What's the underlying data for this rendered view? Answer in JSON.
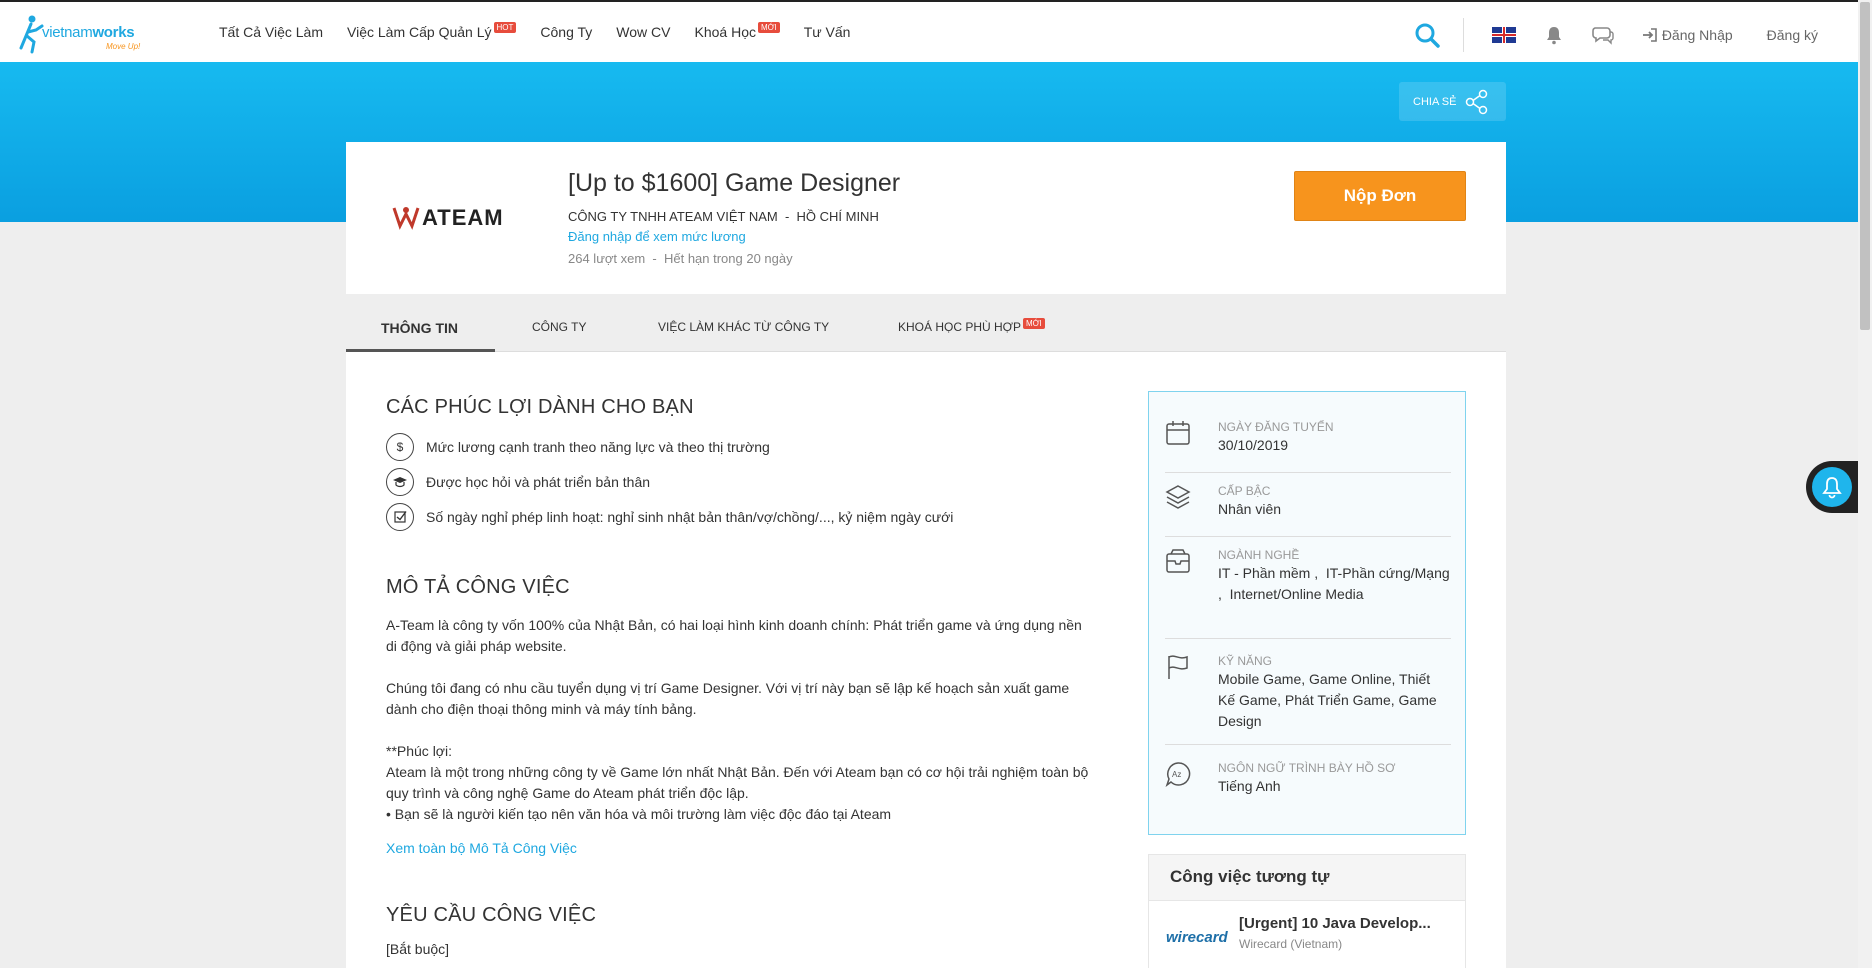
{
  "brand": {
    "name_light": "vietnam",
    "name_bold": "works",
    "tagline": "Move Up!"
  },
  "nav": {
    "items": [
      {
        "label": "Tất Cả Việc Làm",
        "badge": ""
      },
      {
        "label": "Việc Làm Cấp Quản Lý",
        "badge": "HOT"
      },
      {
        "label": "Công Ty",
        "badge": ""
      },
      {
        "label": "Wow CV",
        "badge": ""
      },
      {
        "label": "Khoá Học",
        "badge": "MỚI"
      },
      {
        "label": "Tư Vấn",
        "badge": ""
      }
    ],
    "login": "Đăng Nhập",
    "register": "Đăng ký"
  },
  "share_label": "CHIA SẺ",
  "job": {
    "title": "[Up to $1600] Game Designer",
    "company": "CÔNG TY TNHH ATEAM VIỆT NAM",
    "location": "HỒ CHÍ MINH",
    "company_line": "CÔNG TY TNHH ATEAM VIỆT NAM  -  HỒ CHÍ MINH",
    "salary_login": "Đăng nhập để xem mức lương",
    "meta": "264 lượt xem  -  Hết hạn trong 20 ngày",
    "apply": "Nộp Đơn",
    "company_logo_text": "ATEAM"
  },
  "tabs": [
    {
      "label": "THÔNG TIN"
    },
    {
      "label": "CÔNG TY"
    },
    {
      "label": "VIỆC LÀM KHÁC TỪ CÔNG TY"
    },
    {
      "label": "KHOÁ HỌC PHÙ HỢP",
      "badge": "MỚI"
    }
  ],
  "benefits": {
    "heading": "CÁC PHÚC LỢI DÀNH CHO BẠN",
    "items": [
      {
        "icon": "dollar-icon",
        "text": "Mức lương cạnh tranh theo năng lực và theo thị trường"
      },
      {
        "icon": "graduation-cap-icon",
        "text": "Được học hỏi và phát triển bản thân"
      },
      {
        "icon": "checkbox-icon",
        "text": "Số ngày nghỉ phép linh hoạt: nghỉ sinh nhật bản thân/vợ/chồng/..., kỷ niệm ngày cưới"
      }
    ]
  },
  "description": {
    "heading": "MÔ TẢ CÔNG VIỆC",
    "p1": "A-Team là công ty vốn 100% của Nhật Bản, có hai loại hình kinh doanh chính: Phát triển game và ứng dụng nền di động và giải pháp website.",
    "p2": "Chúng tôi đang có nhu cầu tuyển dụng vị trí Game Designer. Với vị trí này bạn sẽ lập kế hoạch sản xuất game dành cho điện thoại thông minh và máy tính bảng.",
    "p3_title": "**Phúc lợi:",
    "p3_body": "Ateam là một trong những công ty về Game lớn nhất Nhật Bản. Đến với Ateam bạn có cơ hội trải nghiệm toàn bộ quy trình và công nghệ Game do Ateam phát triển độc lập.",
    "p3_bullet": "• Bạn sẽ là người kiến tạo nên văn hóa và môi trường làm việc độc đáo tại Ateam",
    "see_more": "Xem toàn bộ Mô Tả Công Việc"
  },
  "requirements": {
    "heading": "YÊU CẦU CÔNG VIỆC",
    "first_line": "[Bắt buộc]"
  },
  "summary": [
    {
      "icon": "calendar-icon",
      "label": "NGÀY ĐĂNG TUYỂN",
      "value": "30/10/2019"
    },
    {
      "icon": "layers-icon",
      "label": "CẤP BẬC",
      "value": "Nhân viên"
    },
    {
      "icon": "briefcase-icon",
      "label": "NGÀNH NGHỀ",
      "value": "IT - Phần mềm ,  IT-Phần cứng/Mạng ,  Internet/Online Media"
    },
    {
      "icon": "flag-icon",
      "label": "KỸ NĂNG",
      "value": "Mobile Game, Game Online, Thiết Kế Game, Phát Triển Game, Game Design"
    },
    {
      "icon": "language-icon",
      "label": "NGÔN NGỮ TRÌNH BÀY HỒ SƠ",
      "value": "Tiếng Anh"
    }
  ],
  "similar": {
    "heading": "Công việc tương tự",
    "items": [
      {
        "logo_text": "wirecard",
        "title": "[Urgent] 10 Java Develop...",
        "company": "Wirecard (Vietnam)"
      }
    ]
  },
  "colors": {
    "accent": "#1fa8e0",
    "apply": "#f7941d",
    "hero": "#17baf0"
  }
}
